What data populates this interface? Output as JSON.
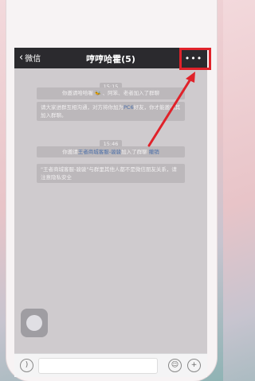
{
  "header": {
    "back_label": "微信",
    "title": "哼哼哈霍(5)",
    "more_label": "•••"
  },
  "messages": {
    "time1": "15:15",
    "sys1_a": "你邀请哈哈喔",
    "sys1_b": "、阿笨、老者加入了群聊",
    "sys2_a": "请大家进群互相沟通，对方将你加为",
    "sys2_link": "PC6",
    "sys2_b": "好友，你才能邀请其加入群聊。",
    "time2": "15:46",
    "sys3_a": "你邀请",
    "sys3_link": "王者商城客服-骏骏",
    "sys3_b": "加入了群聊",
    "sys3_undo": "撤销",
    "sys4": "\"王者商城客服-骏骏\"与群里其他人都不是微信朋友关系，请注意隐私安全"
  },
  "colors": {
    "highlight": "#e0222a",
    "titlebar": "#2b2a2e",
    "link": "#4a6ea8"
  },
  "icons": {
    "voice": "voice-icon",
    "emoji": "emoji-icon",
    "add": "add-icon"
  }
}
